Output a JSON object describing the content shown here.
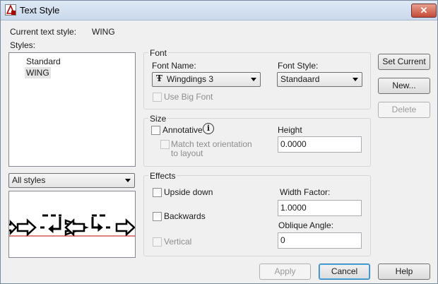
{
  "window": {
    "title": "Text Style",
    "close_glyph": "✕"
  },
  "current_style": {
    "label": "Current text style:",
    "value": "WING"
  },
  "styles": {
    "label": "Styles:",
    "items": [
      "Standard",
      "WING"
    ],
    "selected_index": 1
  },
  "filter": {
    "value": "All styles"
  },
  "font": {
    "group_title": "Font",
    "name_label": "Font Name:",
    "name_value": "Wingdings 3",
    "name_icon": "truetype-font-icon",
    "style_label": "Font Style:",
    "style_value": "Standaard",
    "bigfont_label": "Use Big Font",
    "bigfont_checked": false,
    "bigfont_enabled": false
  },
  "size": {
    "group_title": "Size",
    "annotative_label": "Annotative",
    "annotative_checked": false,
    "info_glyph": "i",
    "match_label_line1": "Match text orientation",
    "match_label_line2": "to layout",
    "match_enabled": false,
    "height_label": "Height",
    "height_value": "0.0000"
  },
  "effects": {
    "group_title": "Effects",
    "upside_down_label": "Upside down",
    "backwards_label": "Backwards",
    "vertical_label": "Vertical",
    "vertical_enabled": false,
    "width_factor_label": "Width Factor:",
    "width_factor_value": "1.0000",
    "oblique_label": "Oblique Angle:",
    "oblique_value": "0"
  },
  "buttons": {
    "set_current": "Set Current",
    "new": "New...",
    "delete": "Delete",
    "delete_enabled": false,
    "apply": "Apply",
    "apply_enabled": false,
    "cancel": "Cancel",
    "help": "Help"
  },
  "colors": {
    "baseline": "#c00000",
    "title_gradient_top": "#dfe9f5",
    "close_button": "#c64a36"
  }
}
